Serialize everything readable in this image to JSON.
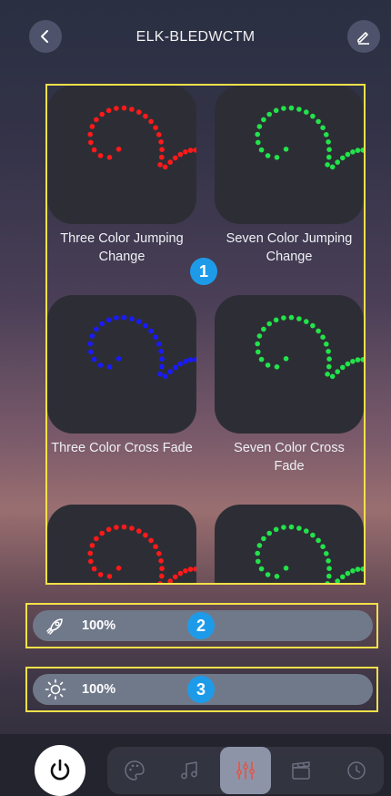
{
  "header": {
    "title": "ELK-BLEDWCTM",
    "back_icon": "chevron-left-icon",
    "edit_icon": "pencil-icon"
  },
  "modes": [
    {
      "label": "Three Color Jumping Change",
      "color": "#ff1a1a"
    },
    {
      "label": "Seven Color Jumping Change",
      "color": "#22e34a"
    },
    {
      "label": "Three Color Cross Fade",
      "color": "#1a1aff"
    },
    {
      "label": "Seven Color Cross Fade",
      "color": "#22e34a"
    },
    {
      "label": "",
      "color": "#ff1a1a"
    },
    {
      "label": "",
      "color": "#22e34a"
    }
  ],
  "speed": {
    "icon": "rocket-icon",
    "value": "100%"
  },
  "brightness": {
    "icon": "sun-icon",
    "value": "100%"
  },
  "annotations": {
    "grid": "1",
    "speed": "2",
    "brightness": "3"
  },
  "bottom_nav": {
    "power_icon": "power-icon",
    "items": [
      {
        "icon": "palette-icon",
        "active": false
      },
      {
        "icon": "music-note-icon",
        "active": false
      },
      {
        "icon": "sliders-icon",
        "active": true
      },
      {
        "icon": "clapperboard-icon",
        "active": false
      },
      {
        "icon": "clock-icon",
        "active": false
      }
    ]
  }
}
